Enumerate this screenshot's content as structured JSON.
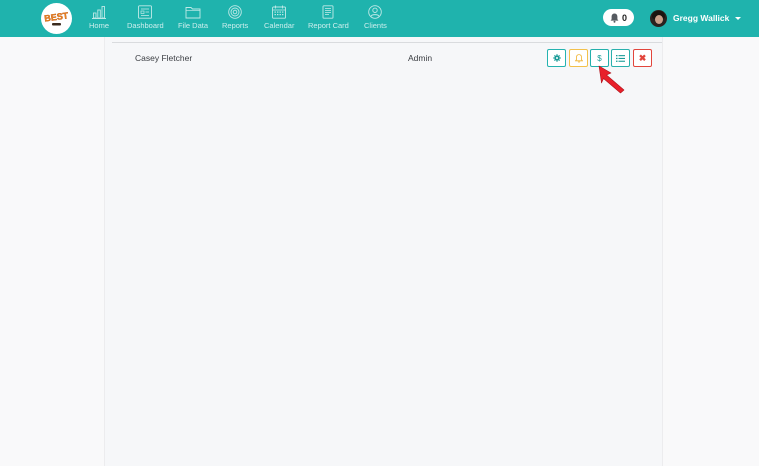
{
  "brand": {
    "logo_text": "BEST",
    "accent": "#1fb3ad"
  },
  "nav": [
    {
      "label": "Home",
      "icon": "bar-chart-icon"
    },
    {
      "label": "Dashboard",
      "icon": "dashboard-icon"
    },
    {
      "label": "File Data",
      "icon": "folder-icon"
    },
    {
      "label": "Reports",
      "icon": "target-icon"
    },
    {
      "label": "Calendar",
      "icon": "calendar-icon"
    },
    {
      "label": "Report Card",
      "icon": "report-card-icon"
    },
    {
      "label": "Clients",
      "icon": "user-circle-icon"
    }
  ],
  "notifications": {
    "count": "0"
  },
  "user": {
    "name": "Gregg Wallick"
  },
  "row": {
    "name": "Casey Fletcher",
    "role": "Admin",
    "actions": [
      {
        "name": "settings",
        "icon": "gear-icon",
        "color": "#25b3b0"
      },
      {
        "name": "notify",
        "icon": "bell-icon",
        "color": "#f3c14c"
      },
      {
        "name": "billing",
        "label": "$",
        "color": "#23b0ac"
      },
      {
        "name": "list",
        "icon": "list-icon",
        "color": "#2ab0ad"
      },
      {
        "name": "delete",
        "label": "✖",
        "color": "#e2453c"
      }
    ]
  },
  "pointer": {
    "icon": "cursor-arrow-icon",
    "color": "#e8202a"
  }
}
